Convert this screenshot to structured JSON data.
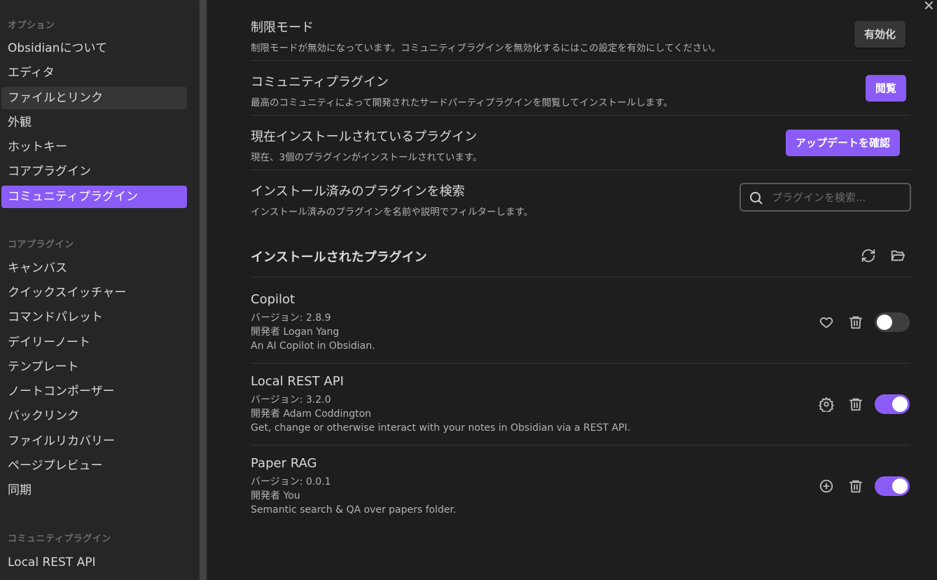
{
  "sidebar": {
    "sections": [
      {
        "heading": "オプション",
        "items": [
          "Obsidianについて",
          "エディタ",
          "ファイルとリンク",
          "外観",
          "ホットキー",
          "コアプラグイン",
          "コミュニティプラグイン"
        ]
      },
      {
        "heading": "コアプラグイン",
        "items": [
          "キャンバス",
          "クイックスイッチャー",
          "コマンドパレット",
          "デイリーノート",
          "テンプレート",
          "ノートコンポーザー",
          "バックリンク",
          "ファイルリカバリー",
          "ページプレビュー",
          "同期"
        ]
      },
      {
        "heading": "コミュニティプラグイン",
        "items": [
          "Local REST API"
        ]
      }
    ],
    "active_item": "コミュニティプラグイン",
    "hover_item": "ファイルとリンク"
  },
  "settings": {
    "restricted": {
      "name": "制限モード",
      "desc": "制限モードが無効になっています。コミュニティプラグインを無効化するにはこの設定を有効にしてください。",
      "button": "有効化"
    },
    "community": {
      "name": "コミュニティプラグイン",
      "desc": "最高のコミュニティによって開発されたサードパーティプラグインを閲覧してインストールします。",
      "button": "閲覧"
    },
    "installed": {
      "name": "現在インストールされているプラグイン",
      "desc": "現在、3個のプラグインがインストールされています。",
      "button": "アップデートを確認"
    },
    "search": {
      "name": "インストール済みのプラグインを検索",
      "desc": "インストール済みのプラグインを名前や説明でフィルターします。",
      "placeholder": "プラグインを検索..."
    }
  },
  "installed_section": {
    "title": "インストールされたプラグイン"
  },
  "plugins": [
    {
      "name": "Copilot",
      "version": "バージョン: 2.8.9",
      "author": "開発者 Logan Yang",
      "desc": "An AI Copilot in Obsidian.",
      "action_icon": "heart-icon",
      "enabled": false
    },
    {
      "name": "Local REST API",
      "version": "バージョン: 3.2.0",
      "author": "開発者 Adam Coddington",
      "desc": "Get, change or otherwise interact with your notes in Obsidian via a REST API.",
      "action_icon": "gear-icon",
      "enabled": true
    },
    {
      "name": "Paper RAG",
      "version": "バージョン: 0.0.1",
      "author": "開発者 You",
      "desc": "Semantic search & QA over papers folder.",
      "action_icon": "plus-circle-icon",
      "enabled": true
    }
  ],
  "colors": {
    "accent": "#8a5cf5",
    "background": "#1e1e1e",
    "sidebar": "#262626"
  }
}
